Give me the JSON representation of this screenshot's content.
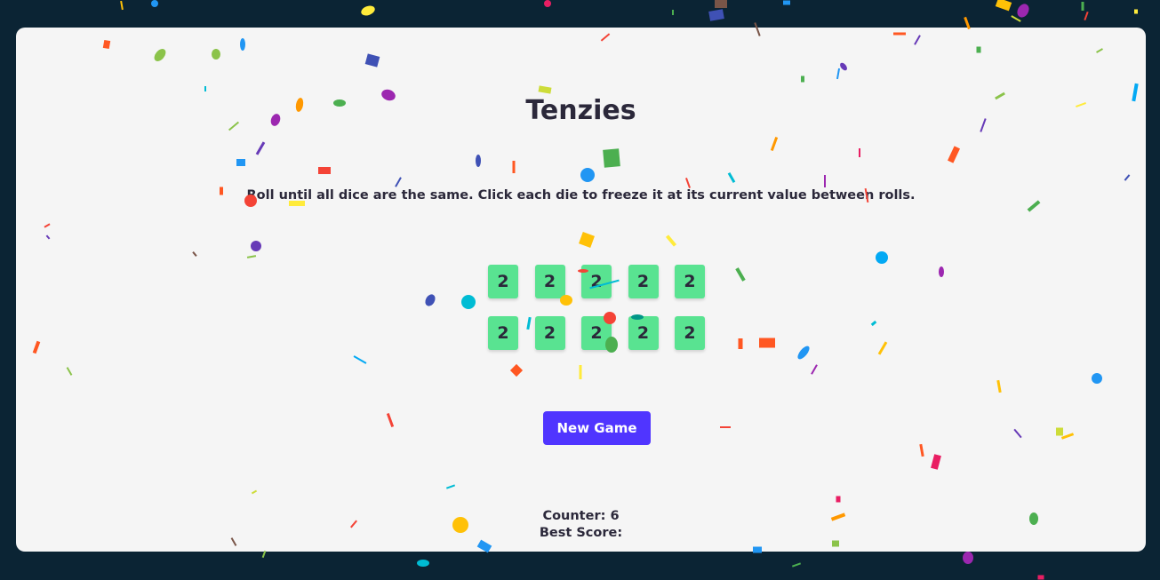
{
  "app": {
    "title": "Tenzies",
    "instructions": "Roll until all dice are the same. Click each die to freeze it at its current value between rolls."
  },
  "dice": [
    {
      "value": "2",
      "held": true
    },
    {
      "value": "2",
      "held": true
    },
    {
      "value": "2",
      "held": true
    },
    {
      "value": "2",
      "held": true
    },
    {
      "value": "2",
      "held": true
    },
    {
      "value": "2",
      "held": true
    },
    {
      "value": "2",
      "held": true
    },
    {
      "value": "2",
      "held": true
    },
    {
      "value": "2",
      "held": true
    },
    {
      "value": "2",
      "held": true
    }
  ],
  "controls": {
    "new_game_label": "New Game"
  },
  "stats": {
    "counter_label": "Counter: 6",
    "best_score_label": "Best Score:"
  },
  "colors": {
    "background": "#0b2434",
    "card": "#f5f5f5",
    "held_die": "#59e391",
    "button": "#5035ff",
    "text": "#2b283a"
  },
  "confetti_colors": [
    "#f44336",
    "#e91e63",
    "#9c27b0",
    "#673ab7",
    "#3f51b5",
    "#2196f3",
    "#03a9f4",
    "#00bcd4",
    "#009688",
    "#4caf50",
    "#8bc34a",
    "#cddc39",
    "#ffeb3b",
    "#ffc107",
    "#ff9800",
    "#ff5722",
    "#795548"
  ]
}
